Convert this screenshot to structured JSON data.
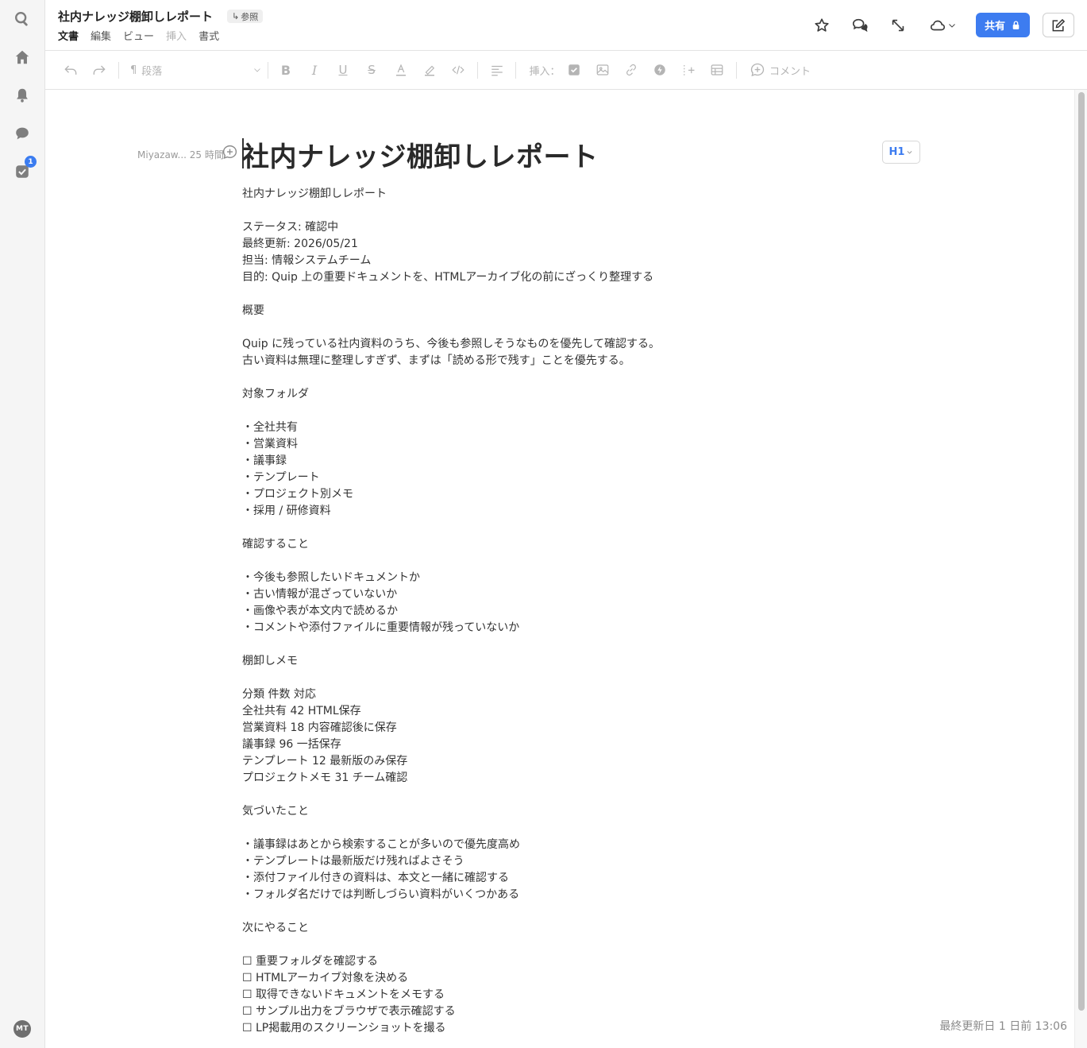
{
  "header": {
    "title": "社内ナレッジ棚卸しレポート",
    "ref_label": "参照",
    "menu": [
      "文書",
      "編集",
      "ビュー",
      "挿入",
      "書式"
    ],
    "share_label": "共有"
  },
  "toolbar": {
    "paragraph_label": "段落",
    "insert_label": "挿入：",
    "comment_label": "コメント"
  },
  "rail": {
    "task_badge": "1",
    "avatar_initials": "MT"
  },
  "document": {
    "author_note": "Miyazaw... 25 時間",
    "heading_style": "H1",
    "title": "社内ナレッジ棚卸しレポート",
    "lines": [
      "社内ナレッジ棚卸しレポート",
      "",
      "ステータス: 確認中",
      "最終更新: 2026/05/21",
      "担当: 情報システムチーム",
      "目的: Quip 上の重要ドキュメントを、HTMLアーカイブ化の前にざっくり整理する",
      "",
      "概要",
      "",
      "Quip に残っている社内資料のうち、今後も参照しそうなものを優先して確認する。",
      "古い資料は無理に整理しすぎず、まずは「読める形で残す」ことを優先する。",
      "",
      "対象フォルダ",
      "",
      "・全社共有",
      "・営業資料",
      "・議事録",
      "・テンプレート",
      "・プロジェクト別メモ",
      "・採用 / 研修資料",
      "",
      "確認すること",
      "",
      "・今後も参照したいドキュメントか",
      "・古い情報が混ざっていないか",
      "・画像や表が本文内で読めるか",
      "・コメントや添付ファイルに重要情報が残っていないか",
      "",
      "棚卸しメモ",
      "",
      "分類 件数 対応",
      "全社共有 42 HTML保存",
      "営業資料 18 内容確認後に保存",
      "議事録 96 一括保存",
      "テンプレート 12 最新版のみ保存",
      "プロジェクトメモ 31 チーム確認",
      "",
      "気づいたこと",
      "",
      "・議事録はあとから検索することが多いので優先度高め",
      "・テンプレートは最新版だけ残ればよさそう",
      "・添付ファイル付きの資料は、本文と一緒に確認する",
      "・フォルダ名だけでは判断しづらい資料がいくつかある",
      "",
      "次にやること",
      "",
      "☐ 重要フォルダを確認する",
      "☐ HTMLアーカイブ対象を決める",
      "☐ 取得できないドキュメントをメモする",
      "☐ サンプル出力をブラウザで表示確認する",
      "☐ LP掲載用のスクリーンショットを撮る"
    ]
  },
  "footer": {
    "last_updated": "最終更新日 1 日前 13:06"
  }
}
